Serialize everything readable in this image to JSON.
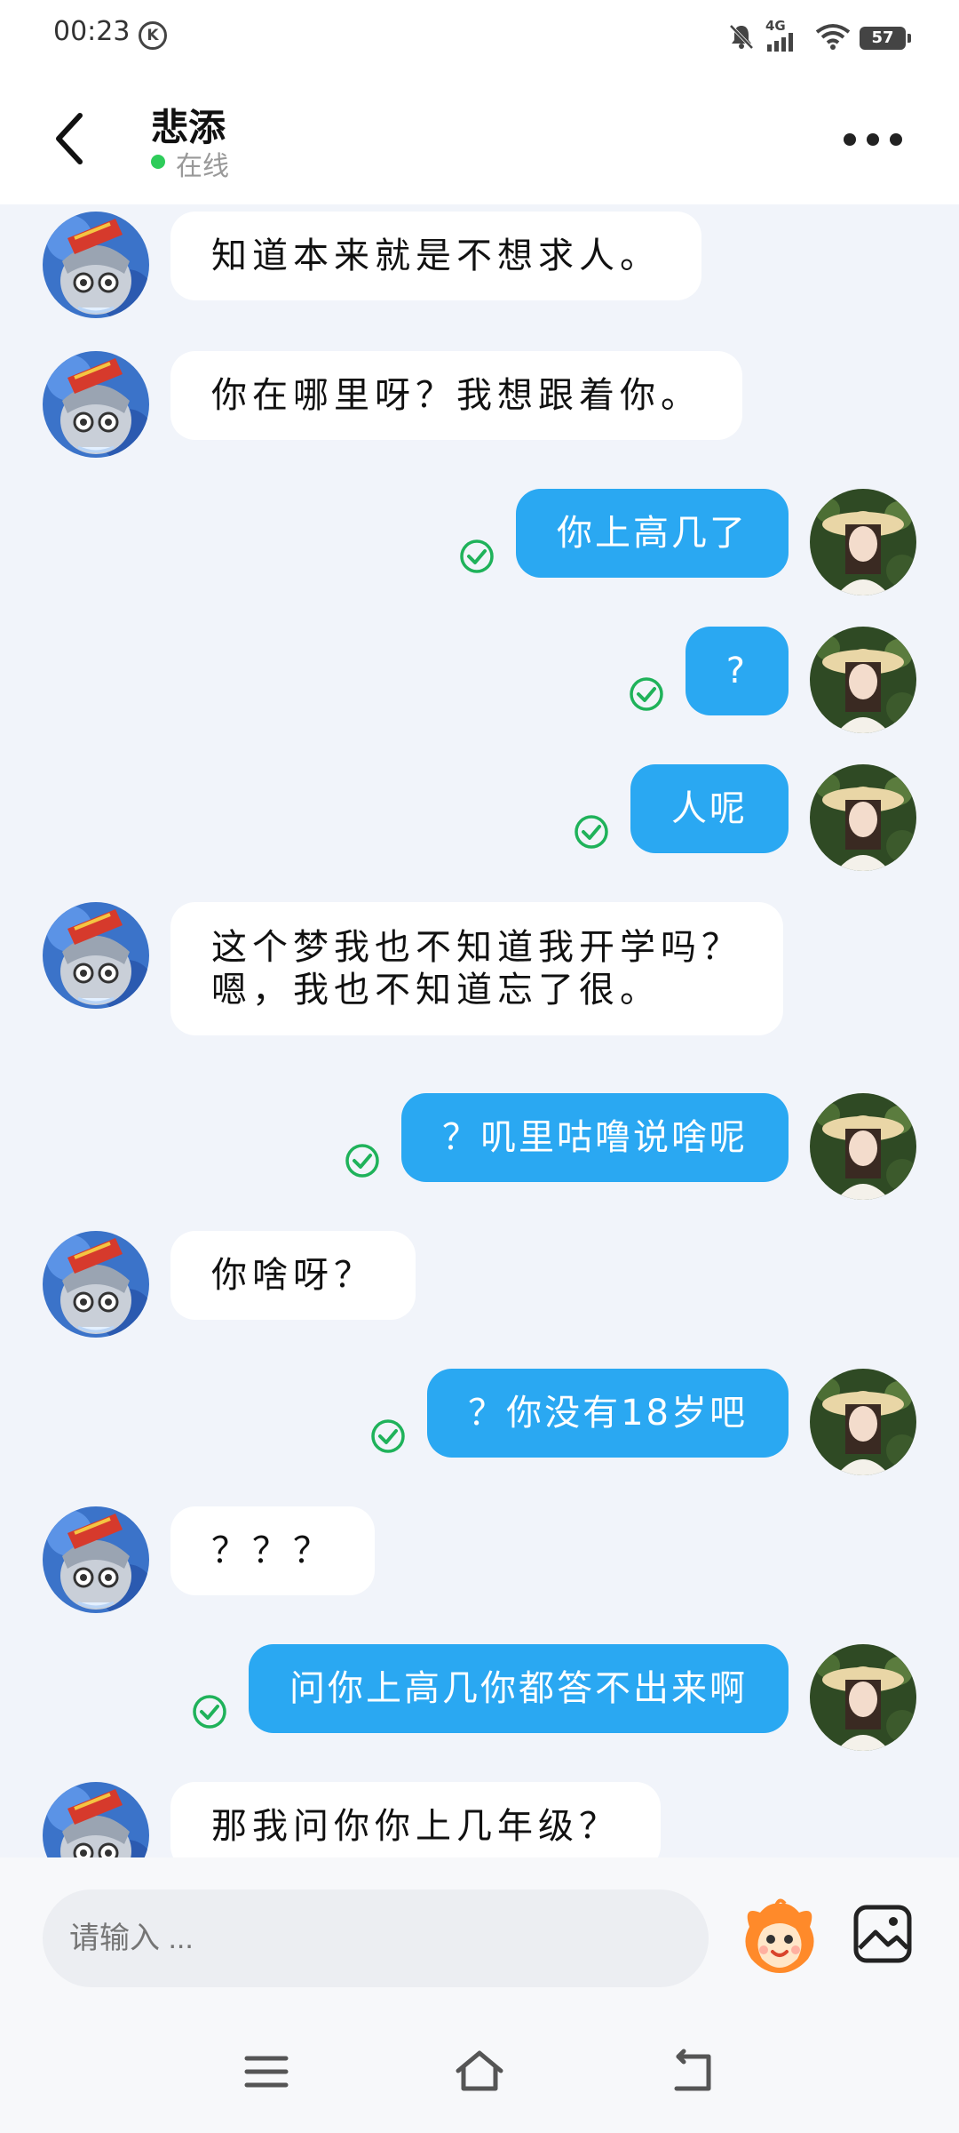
{
  "status_bar": {
    "time": "00:23",
    "k_badge": "K",
    "network": "4G",
    "battery": "57"
  },
  "header": {
    "name": "悲添",
    "status": "在线",
    "back_icon": "chevron-left-icon",
    "more_icon": "more-dots-icon"
  },
  "messages": [
    {
      "side": "in",
      "text": "知道本来就是不想求人。"
    },
    {
      "side": "in",
      "text": "你在哪里呀？我想跟着你。"
    },
    {
      "side": "out",
      "text": "你上高几了",
      "status": "read"
    },
    {
      "side": "out",
      "text": "?",
      "status": "read"
    },
    {
      "side": "out",
      "text": "人呢",
      "status": "read"
    },
    {
      "side": "in",
      "lines": [
        "这个梦我也不知道我开学吗？",
        "嗯，我也不知道忘了很。"
      ]
    },
    {
      "side": "out",
      "text": "？叽里咕噜说啥呢",
      "status": "read"
    },
    {
      "side": "in",
      "text": "你啥呀？"
    },
    {
      "side": "out",
      "text": "？你没有18岁吧",
      "status": "read"
    },
    {
      "side": "in",
      "text": "？？？"
    },
    {
      "side": "out",
      "text": "问你上高几你都答不出来啊",
      "status": "read"
    },
    {
      "side": "in",
      "text": "那我问你你上几年级？"
    }
  ],
  "input": {
    "placeholder": "请输入 ..."
  },
  "colors": {
    "outgoing_bubble": "#2aa8f2",
    "incoming_bubble": "#ffffff",
    "read_check": "#1fb25a",
    "online_dot": "#2ecc5a"
  }
}
